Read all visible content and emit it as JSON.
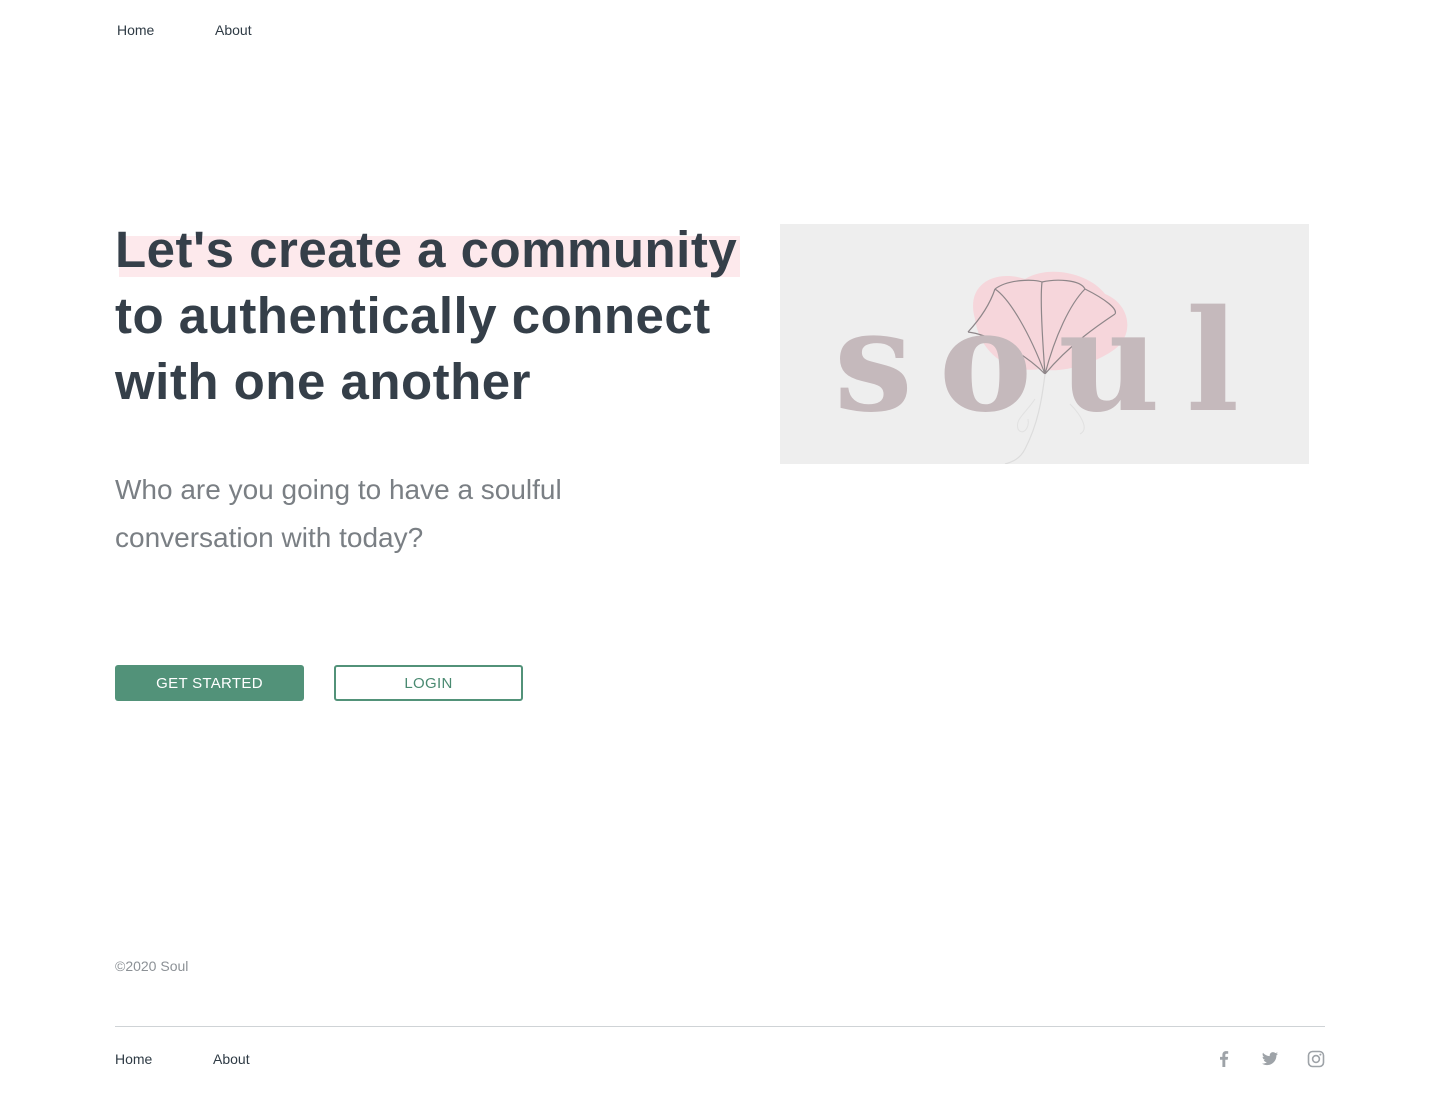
{
  "top_nav": {
    "home": "Home",
    "about": "About"
  },
  "hero": {
    "headline_line1": "Let's create a community",
    "headline_line2": "to authentically connect",
    "headline_line3": "with one another",
    "subhead_line1": "Who are you going to have a soulful",
    "subhead_line2": "conversation with today?",
    "get_started_label": "GET STARTED",
    "login_label": "LOGIN"
  },
  "logo": {
    "wordmark": "soul"
  },
  "footer": {
    "copyright": "©2020 Soul",
    "home": "Home",
    "about": "About",
    "social_icons": [
      "facebook-icon",
      "twitter-icon",
      "instagram-icon"
    ]
  },
  "colors": {
    "primary_green": "#529279",
    "heading_text": "#353f49",
    "muted_text": "#7a7f84",
    "highlight_pink": "#fde9ec",
    "logo_text": "#c5b9bc",
    "logo_flower": "#f6c9d0",
    "logo_background": "#eeeeee"
  }
}
